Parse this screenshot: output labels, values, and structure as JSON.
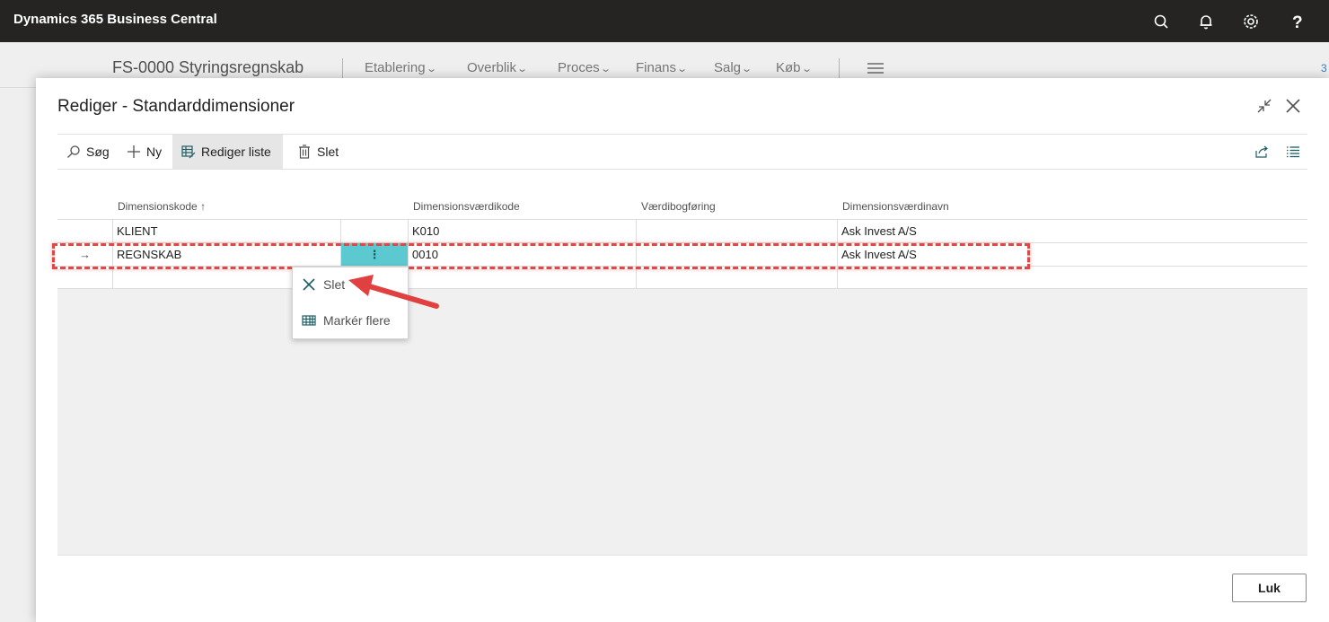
{
  "appbar": {
    "brand": "Dynamics 365 Business Central",
    "icons": [
      "search-icon",
      "bell-icon",
      "gear-icon",
      "help-icon"
    ]
  },
  "background_page": {
    "title": "FS-0000 Styringsregnskab",
    "menu": [
      "Etablering",
      "Overblik",
      "Proces",
      "Finans",
      "Salg",
      "Køb"
    ],
    "edge_text": "3"
  },
  "dialog": {
    "title": "Rediger - Standarddimensioner",
    "actions": {
      "search": "Søg",
      "new": "Ny",
      "edit_list": "Rediger liste",
      "delete": "Slet"
    },
    "columns": {
      "dimension_code": "Dimensionskode",
      "dimension_code_sort": "↑",
      "dimension_value_code": "Dimensionsværdikode",
      "value_posting": "Værdibogføring",
      "dimension_value_name": "Dimensionsværdinavn"
    },
    "rows": [
      {
        "marker": "",
        "dimension_code": "KLIENT",
        "dimension_value_code": "K010",
        "value_posting": "",
        "dimension_value_name": "Ask Invest A/S"
      },
      {
        "marker": "→",
        "dimension_code": "REGNSKAB",
        "dimension_value_code": "0010",
        "value_posting": "",
        "dimension_value_name": "Ask Invest A/S"
      }
    ],
    "row_menu_glyph": "⋮",
    "context_menu": {
      "delete": "Slet",
      "select_more": "Markér flere"
    },
    "close_button": "Luk"
  },
  "colors": {
    "appbar_bg": "#252423",
    "accent_teal": "#5cc8cf",
    "highlight_red": "#e04747"
  }
}
